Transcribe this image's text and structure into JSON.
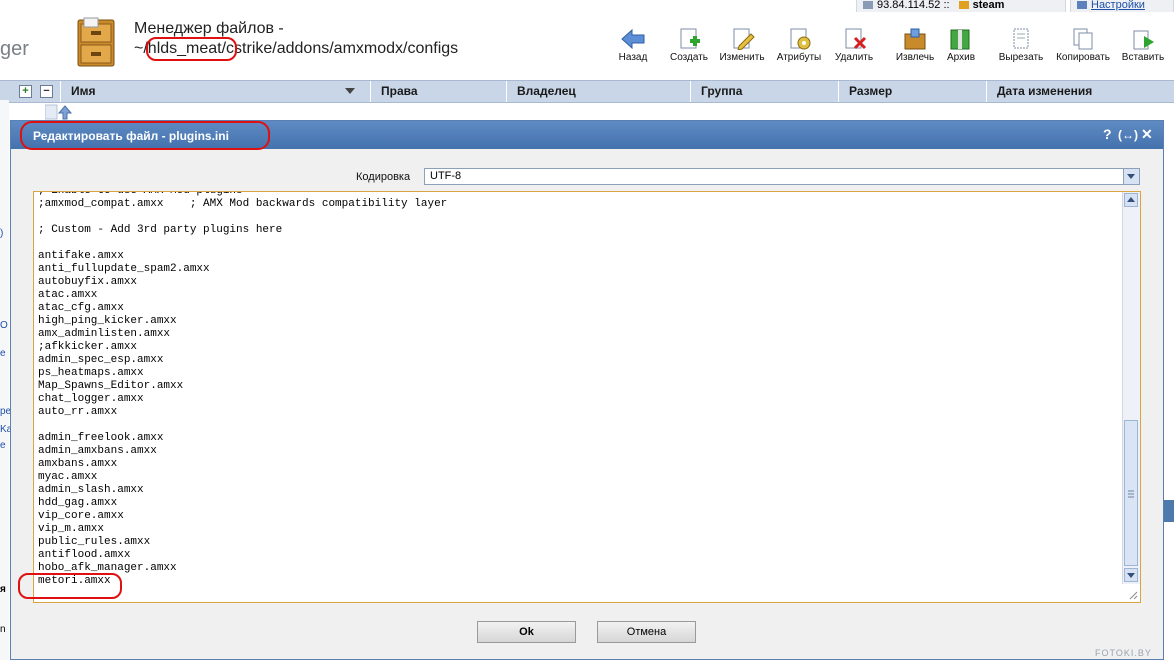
{
  "header": {
    "status_ip": "93.84.114.52 ::",
    "status_user": "steam",
    "settings_link": "Настройки",
    "logo_fragment": "ger",
    "title_line1": "Менеджер файлов -",
    "title_line2": "~/hlds_meat/cstrike/addons/amxmodx/configs"
  },
  "toolbar": {
    "back": "Назад",
    "create": "Создать",
    "edit": "Изменить",
    "attributes": "Атрибуты",
    "delete": "Удалить",
    "extract": "Извлечь",
    "archive": "Архив",
    "cut": "Вырезать",
    "copy": "Копировать",
    "paste": "Вставить"
  },
  "columns": {
    "name": "Имя",
    "rights": "Права",
    "owner": "Владелец",
    "group": "Группа",
    "size": "Размер",
    "modified": "Дата изменения"
  },
  "tree": {
    "expand": "+",
    "collapse": "−"
  },
  "background": {
    "fragments": [
      ")",
      "O",
      "e",
      "pe",
      "Ka",
      "e",
      "я",
      "n"
    ]
  },
  "modal": {
    "title": "Редактировать файл - plugins.ini",
    "help": "?",
    "maximize": "(↔)",
    "close": "✕",
    "encoding_label": "Кодировка",
    "encoding_value": "UTF-8",
    "lines": [
      "; Enable to use AMX Mod plugins",
      ";amxmod_compat.amxx    ; AMX Mod backwards compatibility layer",
      "",
      "; Custom - Add 3rd party plugins here",
      "",
      "antifake.amxx",
      "anti_fullupdate_spam2.amxx",
      "autobuyfix.amxx",
      "atac.amxx",
      "atac_cfg.amxx",
      "high_ping_kicker.amxx",
      "amx_adminlisten.amxx",
      ";afkkicker.amxx",
      "admin_spec_esp.amxx",
      "ps_heatmaps.amxx",
      "Map_Spawns_Editor.amxx",
      "chat_logger.amxx",
      "auto_rr.amxx",
      "",
      "admin_freelook.amxx",
      "admin_amxbans.amxx",
      "amxbans.amxx",
      "myac.amxx",
      "admin_slash.amxx",
      "hdd_gag.amxx",
      "vip_core.amxx",
      "vip_m.amxx",
      "public_rules.amxx",
      "antiflood.amxx",
      "hobo_afk_manager.amxx",
      "metori.amxx"
    ],
    "ok_label": "Ok",
    "cancel_label": "Отмена"
  },
  "watermark": "FOTOKI.BY",
  "colors": {
    "header_bg": "#c9d6e8",
    "modal_title": "#4f7cb8",
    "annotation_red": "#e01010",
    "editor_border": "#d9a441"
  }
}
